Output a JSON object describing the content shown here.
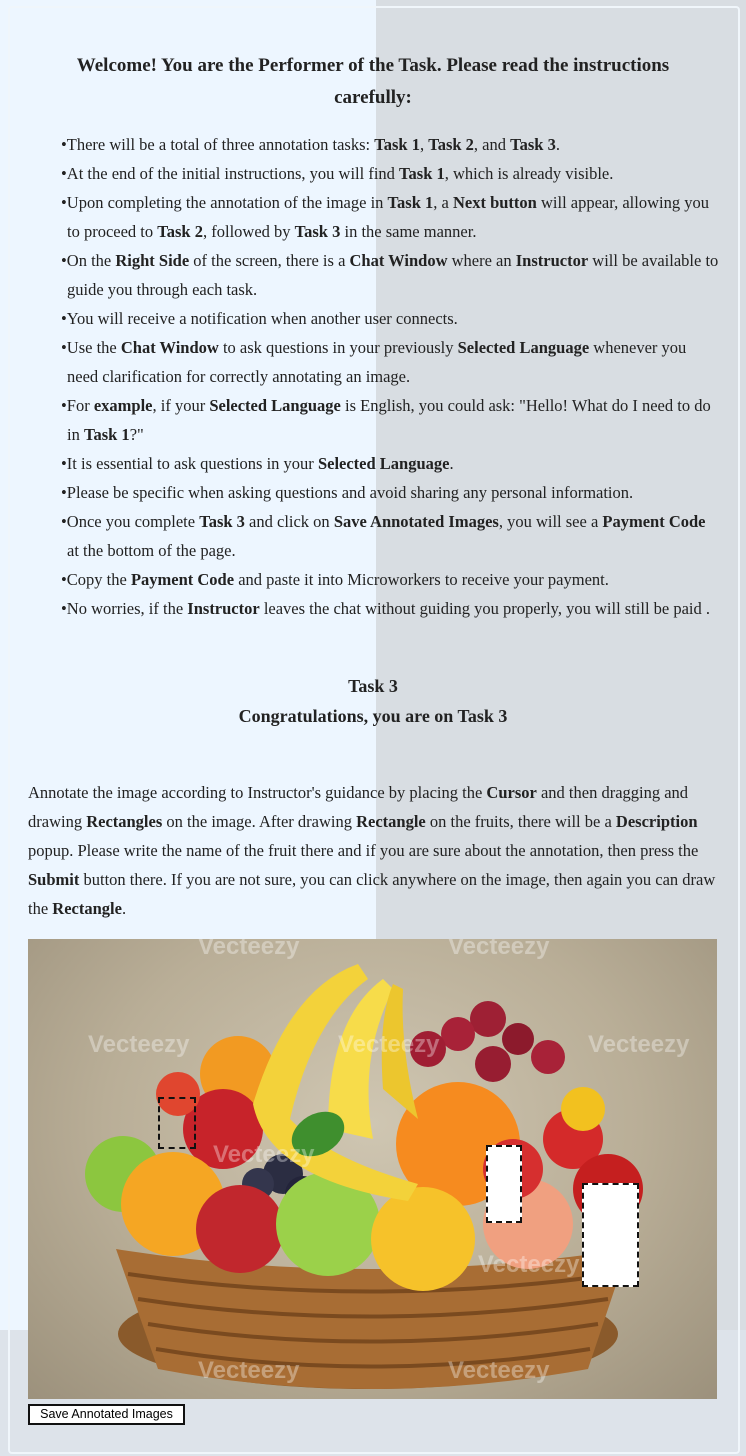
{
  "welcome": {
    "line1": "Welcome! You are the Performer of the Task. Please read the instructions",
    "line2": "carefully:"
  },
  "instructions": [
    [
      {
        "t": "There will be a total of three annotation tasks: "
      },
      {
        "b": "Task 1"
      },
      {
        "t": ", "
      },
      {
        "b": "Task 2"
      },
      {
        "t": ", and "
      },
      {
        "b": "Task 3"
      },
      {
        "t": "."
      }
    ],
    [
      {
        "t": "At the end of the initial instructions, you will find "
      },
      {
        "b": "Task 1"
      },
      {
        "t": ", which is already visible."
      }
    ],
    [
      {
        "t": "Upon completing the annotation of the image in "
      },
      {
        "b": "Task 1"
      },
      {
        "t": ", a "
      },
      {
        "b": "Next button"
      },
      {
        "t": " will appear, allowing you to proceed to "
      },
      {
        "b": "Task 2"
      },
      {
        "t": ", followed by "
      },
      {
        "b": "Task 3"
      },
      {
        "t": " in the same manner."
      }
    ],
    [
      {
        "t": "On the "
      },
      {
        "b": "Right Side"
      },
      {
        "t": " of the screen, there is a "
      },
      {
        "b": "Chat Window"
      },
      {
        "t": " where an "
      },
      {
        "b": "Instructor"
      },
      {
        "t": " will be available to guide you through each task."
      }
    ],
    [
      {
        "t": "You will receive a notification when another user connects."
      }
    ],
    [
      {
        "t": "Use the "
      },
      {
        "b": "Chat Window"
      },
      {
        "t": " to ask questions in your previously "
      },
      {
        "b": "Selected Language"
      },
      {
        "t": " whenever you need clarification for correctly annotating an image."
      }
    ],
    [
      {
        "t": "For "
      },
      {
        "b": "example"
      },
      {
        "t": ", if your "
      },
      {
        "b": "Selected Language"
      },
      {
        "t": " is English, you could ask: \"Hello! What do I need to do in "
      },
      {
        "b": "Task 1"
      },
      {
        "t": "?\""
      }
    ],
    [
      {
        "t": "It is essential to ask questions in your "
      },
      {
        "b": "Selected Language"
      },
      {
        "t": "."
      }
    ],
    [
      {
        "t": "Please be specific when asking questions and avoid sharing any personal information."
      }
    ],
    [
      {
        "t": "Once you complete "
      },
      {
        "b": "Task 3"
      },
      {
        "t": " and click on "
      },
      {
        "b": "Save Annotated Images"
      },
      {
        "t": ", you will see a "
      },
      {
        "b": "Payment Code"
      },
      {
        "t": " at the bottom of the page."
      }
    ],
    [
      {
        "t": "Copy the "
      },
      {
        "b": "Payment Code"
      },
      {
        "t": " and paste it into Microworkers to receive your payment."
      }
    ],
    [
      {
        "t": "No worries, if the "
      },
      {
        "b": "Instructor"
      },
      {
        "t": " leaves the chat without guiding you properly, you will still be paid ."
      }
    ]
  ],
  "task": {
    "title": "Task 3",
    "subtitle": "Congratulations, you are on Task 3"
  },
  "description": [
    {
      "t": "Annotate the image according to Instructor's guidance by placing the "
    },
    {
      "b": "Cursor"
    },
    {
      "t": " and then dragging and drawing "
    },
    {
      "b": "Rectangles"
    },
    {
      "t": " on the image. After drawing "
    },
    {
      "b": "Rectangle"
    },
    {
      "t": " on the fruits, there will be a "
    },
    {
      "b": "Description"
    },
    {
      "t": " popup. Please write the name of the fruit there and if you are sure about the annotation, then press the "
    },
    {
      "b": "Submit"
    },
    {
      "t": " button there. If you are not sure, you can click anywhere on the image, then again you can draw the "
    },
    {
      "b": "Rectangle"
    },
    {
      "t": "."
    }
  ],
  "image": {
    "watermark": "Vecteezy",
    "annotations_count": 3
  },
  "save_button": "Save Annotated Images"
}
